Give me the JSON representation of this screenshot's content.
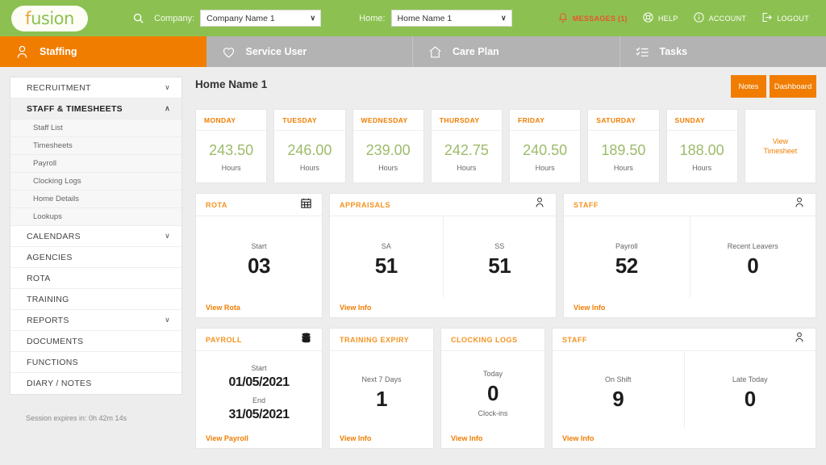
{
  "header": {
    "logo": {
      "first": "f",
      "rest": "usion"
    },
    "search_icon": "search-icon",
    "company_label": "Company:",
    "company_value": "Company Name 1",
    "home_label": "Home:",
    "home_value": "Home Name 1",
    "caret": "∨",
    "actions": [
      {
        "icon": "bell-icon",
        "label": "MESSAGES (1)",
        "alert": true
      },
      {
        "icon": "lifebuoy-icon",
        "label": "HELP",
        "alert": false
      },
      {
        "icon": "info-circle-icon",
        "label": "ACCOUNT",
        "alert": false
      },
      {
        "icon": "logout-icon",
        "label": "LOGOUT",
        "alert": false
      }
    ]
  },
  "nav_tabs": [
    {
      "label": "Staffing",
      "icon": "person-icon",
      "active": true
    },
    {
      "label": "Service User",
      "icon": "heart-icon",
      "active": false
    },
    {
      "label": "Care Plan",
      "icon": "home-icon",
      "active": false
    },
    {
      "label": "Tasks",
      "icon": "checklist-icon",
      "active": false
    }
  ],
  "sidebar": {
    "items": [
      {
        "label": "RECRUITMENT",
        "chevron": "∨",
        "expanded": false
      },
      {
        "label": "STAFF & TIMESHEETS",
        "chevron": "∧",
        "expanded": true
      },
      {
        "label": "CALENDARS",
        "chevron": "∨",
        "expanded": false
      },
      {
        "label": "AGENCIES",
        "chevron": "",
        "expanded": false
      },
      {
        "label": "ROTA",
        "chevron": "",
        "expanded": false
      },
      {
        "label": "TRAINING",
        "chevron": "",
        "expanded": false
      },
      {
        "label": "REPORTS",
        "chevron": "∨",
        "expanded": false
      },
      {
        "label": "DOCUMENTS",
        "chevron": "",
        "expanded": false
      },
      {
        "label": "FUNCTIONS",
        "chevron": "",
        "expanded": false
      },
      {
        "label": "DIARY / NOTES",
        "chevron": "",
        "expanded": false
      }
    ],
    "submenu": [
      {
        "label": "Staff List"
      },
      {
        "label": "Timesheets"
      },
      {
        "label": "Payroll"
      },
      {
        "label": "Clocking Logs"
      },
      {
        "label": "Home Details"
      },
      {
        "label": "Lookups"
      }
    ],
    "session": "Session expires in: 0h 42m 14s"
  },
  "main": {
    "page_title": "Home Name 1",
    "buttons": {
      "notes": "Notes",
      "dashboard": "Dashboard"
    },
    "days": [
      {
        "day": "MONDAY",
        "hours": "243.50",
        "unit": "Hours"
      },
      {
        "day": "TUESDAY",
        "hours": "246.00",
        "unit": "Hours"
      },
      {
        "day": "WEDNESDAY",
        "hours": "239.00",
        "unit": "Hours"
      },
      {
        "day": "THURSDAY",
        "hours": "242.75",
        "unit": "Hours"
      },
      {
        "day": "FRIDAY",
        "hours": "240.50",
        "unit": "Hours"
      },
      {
        "day": "SATURDAY",
        "hours": "189.50",
        "unit": "Hours"
      },
      {
        "day": "SUNDAY",
        "hours": "188.00",
        "unit": "Hours"
      }
    ],
    "view_timesheet": "View\nTimesheet",
    "view_timesheet_line1": "View",
    "view_timesheet_line2": "Timesheet",
    "panels": {
      "rota": {
        "title": "ROTA",
        "icon": "calendar-icon",
        "stat_label": "Start",
        "stat_value": "03",
        "link": "View Rota"
      },
      "appraisals": {
        "title": "APPRAISALS",
        "icon": "person-icon",
        "col1_label": "SA",
        "col1_value": "51",
        "col2_label": "SS",
        "col2_value": "51",
        "link": "View Info"
      },
      "staff_top": {
        "title": "STAFF",
        "icon": "person-icon",
        "col1_label": "Payroll",
        "col1_value": "52",
        "col2_label": "Recent Leavers",
        "col2_value": "0",
        "link": "View Info"
      },
      "payroll": {
        "title": "PAYROLL",
        "icon": "database-icon",
        "start_label": "Start",
        "start_value": "01/05/2021",
        "end_label": "End",
        "end_value": "31/05/2021",
        "link": "View Payroll"
      },
      "training_expiry": {
        "title": "TRAINING EXPIRY",
        "stat_label": "Next 7 Days",
        "stat_value": "1",
        "link": "View Info"
      },
      "clocking_logs": {
        "title": "CLOCKING LOGS",
        "stat_label": "Today",
        "stat_value": "0",
        "stat_sub": "Clock-ins",
        "link": "View Info"
      },
      "staff_bottom": {
        "title": "STAFF",
        "icon": "person-icon",
        "col1_label": "On Shift",
        "col1_value": "9",
        "col2_label": "Late Today",
        "col2_value": "0",
        "link": "View Info"
      }
    }
  },
  "colors": {
    "brand_green": "#8cc152",
    "accent_orange": "#f07d00",
    "panel_title_orange": "#f4921e",
    "hours_green": "#9cbb6a",
    "alert_red": "#e8542f",
    "tab_grey": "#b3b3b3"
  }
}
